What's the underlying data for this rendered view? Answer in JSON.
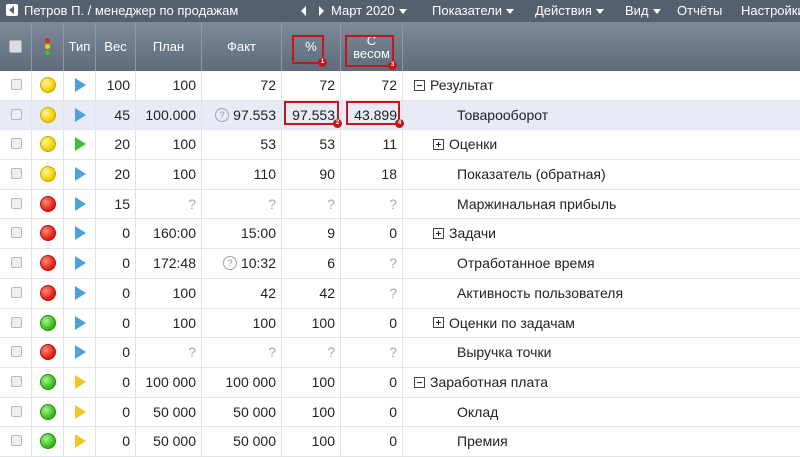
{
  "topbar": {
    "user": "Петров П. / менеджер по продажам",
    "period": "Март 2020",
    "menu": [
      "Показатели",
      "Действия",
      "Вид",
      "Отчёты",
      "Настройки"
    ]
  },
  "columns": {
    "check": "",
    "status": "",
    "type": "Тип",
    "weight": "Вес",
    "plan": "План",
    "fact": "Факт",
    "percent": "%",
    "weighted_line1": "С",
    "weighted_line2": "весом"
  },
  "callouts": [
    "1",
    "2",
    "3",
    "4"
  ],
  "rows": [
    {
      "status": "yellow",
      "type": "blue",
      "weight": "100",
      "plan": "100",
      "fact": "72",
      "fact_hint": false,
      "percent": "72",
      "weighted": "72",
      "name": "Результат",
      "toggle": "minus",
      "level": 0,
      "selected": false
    },
    {
      "status": "yellow",
      "type": "blue",
      "weight": "45",
      "plan": "100.000",
      "fact": "97.553",
      "fact_hint": true,
      "percent": "97.553",
      "weighted": "43.899",
      "name": "Товарооборот",
      "toggle": "",
      "level": 1,
      "selected": true
    },
    {
      "status": "yellow",
      "type": "green",
      "weight": "20",
      "plan": "100",
      "fact": "53",
      "fact_hint": false,
      "percent": "53",
      "weighted": "11",
      "name": "Оценки",
      "toggle": "plus",
      "level": 1,
      "selected": false
    },
    {
      "status": "yellow",
      "type": "blue",
      "weight": "20",
      "plan": "100",
      "fact": "110",
      "fact_hint": false,
      "percent": "90",
      "weighted": "18",
      "name": "Показатель (обратная)",
      "toggle": "",
      "level": 1,
      "selected": false
    },
    {
      "status": "red",
      "type": "blue",
      "weight": "15",
      "plan": "?",
      "fact": "?",
      "fact_hint": false,
      "percent": "?",
      "weighted": "?",
      "name": "Маржинальная прибыль",
      "toggle": "",
      "level": 1,
      "selected": false
    },
    {
      "status": "red",
      "type": "blue",
      "weight": "0",
      "plan": "160:00",
      "fact": "15:00",
      "fact_hint": false,
      "percent": "9",
      "weighted": "0",
      "name": "Задачи",
      "toggle": "plus",
      "level": 1,
      "selected": false
    },
    {
      "status": "red",
      "type": "blue",
      "weight": "0",
      "plan": "172:48",
      "fact": "10:32",
      "fact_hint": true,
      "percent": "6",
      "weighted": "?",
      "name": "Отработанное время",
      "toggle": "",
      "level": 1,
      "selected": false
    },
    {
      "status": "red",
      "type": "blue",
      "weight": "0",
      "plan": "100",
      "fact": "42",
      "fact_hint": false,
      "percent": "42",
      "weighted": "?",
      "name": "Активность пользователя",
      "toggle": "",
      "level": 1,
      "selected": false
    },
    {
      "status": "green",
      "type": "blue",
      "weight": "0",
      "plan": "100",
      "fact": "100",
      "fact_hint": false,
      "percent": "100",
      "weighted": "0",
      "name": "Оценки по задачам",
      "toggle": "plus",
      "level": 1,
      "selected": false
    },
    {
      "status": "red",
      "type": "blue",
      "weight": "0",
      "plan": "?",
      "fact": "?",
      "fact_hint": false,
      "percent": "?",
      "weighted": "?",
      "name": "Выручка точки",
      "toggle": "",
      "level": 1,
      "selected": false
    },
    {
      "status": "green",
      "type": "yellow",
      "weight": "0",
      "plan": "100 000",
      "fact": "100 000",
      "fact_hint": false,
      "percent": "100",
      "weighted": "0",
      "name": "Заработная плата",
      "toggle": "minus",
      "level": 0,
      "selected": false
    },
    {
      "status": "green",
      "type": "yellow",
      "weight": "0",
      "plan": "50 000",
      "fact": "50 000",
      "fact_hint": false,
      "percent": "100",
      "weighted": "0",
      "name": "Оклад",
      "toggle": "",
      "level": 1,
      "selected": false
    },
    {
      "status": "green",
      "type": "yellow",
      "weight": "0",
      "plan": "50 000",
      "fact": "50 000",
      "fact_hint": false,
      "percent": "100",
      "weighted": "0",
      "name": "Премия",
      "toggle": "",
      "level": 1,
      "selected": false
    }
  ],
  "colors": {
    "topbar": "#55606e",
    "header": "#6b7786",
    "highlight": "#c0191b",
    "selected_row": "#e8ebf6"
  }
}
